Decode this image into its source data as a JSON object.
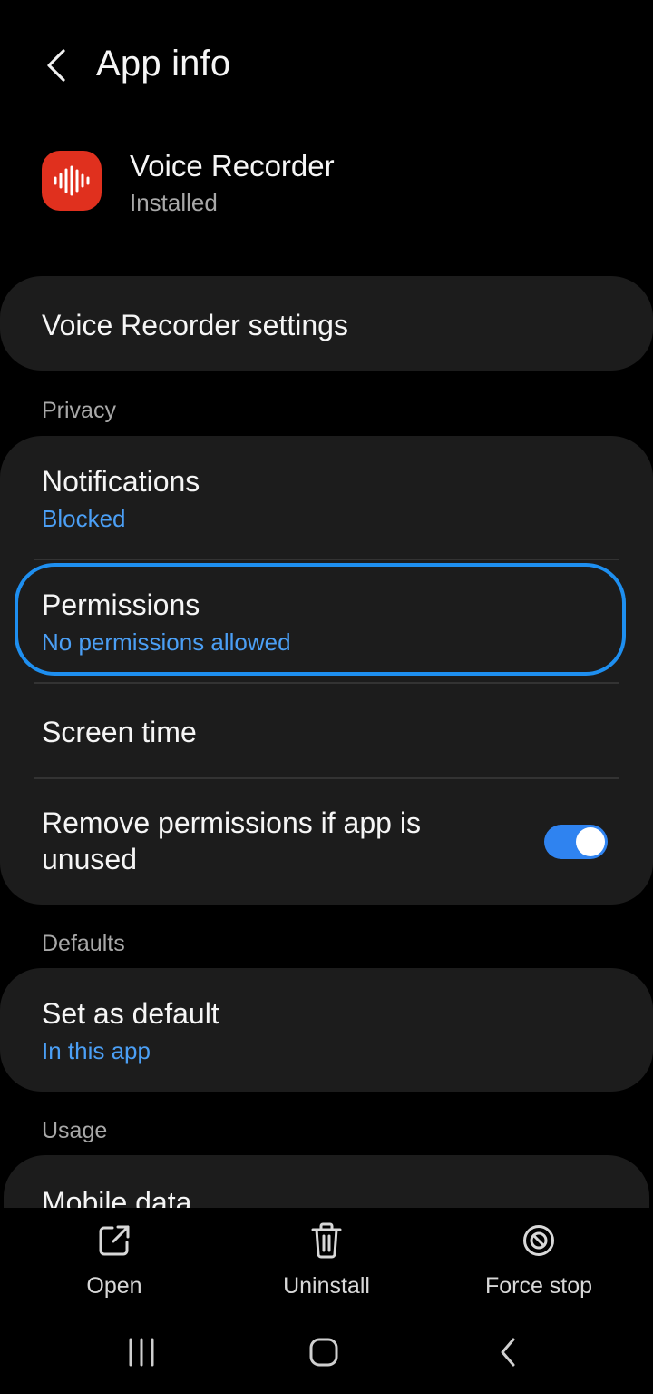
{
  "header": {
    "title": "App info"
  },
  "app": {
    "name": "Voice Recorder",
    "status": "Installed"
  },
  "settings_card": {
    "label": "Voice Recorder settings"
  },
  "privacy": {
    "section_label": "Privacy",
    "notifications": {
      "title": "Notifications",
      "subtitle": "Blocked"
    },
    "permissions": {
      "title": "Permissions",
      "subtitle": "No permissions allowed"
    },
    "screen_time": {
      "title": "Screen time"
    },
    "remove_permissions": {
      "title_line1": "Remove permissions if app is",
      "title_line2": "unused",
      "enabled": true
    }
  },
  "defaults": {
    "section_label": "Defaults",
    "set_default": {
      "title": "Set as default",
      "subtitle": "In this app"
    }
  },
  "usage": {
    "section_label": "Usage",
    "mobile_data": {
      "title": "Mobile data"
    }
  },
  "actions": {
    "open": "Open",
    "uninstall": "Uninstall",
    "force_stop": "Force stop"
  },
  "colors": {
    "accent": "#4b9ff5",
    "focus_ring": "#1e8ff0",
    "card_bg": "#1c1c1c",
    "app_icon_bg": "#e0301e"
  },
  "icons": {
    "back": "chevron-left-icon",
    "open": "open-external-icon",
    "uninstall": "trash-icon",
    "force_stop": "block-icon"
  }
}
